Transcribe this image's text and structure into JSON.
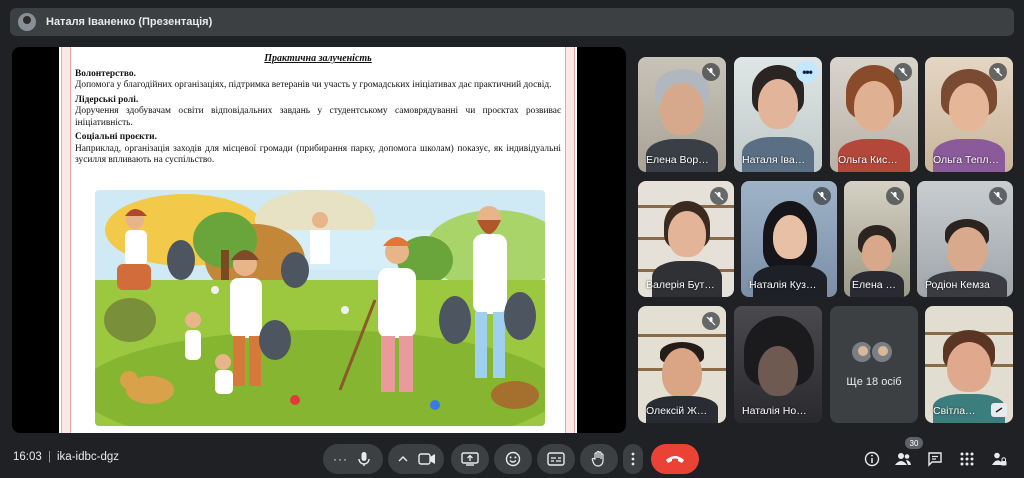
{
  "window": {
    "title": "Наталя Іваненко (Презентація)"
  },
  "slide": {
    "title": "Практична залученість",
    "sections": [
      {
        "heading": "Волонтерство.",
        "text": "Допомога у благодійних організаціях, підтримка ветеранів чи участь у громадських ініціативах дає практичний досвід."
      },
      {
        "heading": "Лідерські ролі.",
        "text": "Доручення здобувачам освіти відповідальних завдань у студентському самоврядуванні чи проєктах розвиває ініціативність."
      },
      {
        "heading": "Соціальні проєкти.",
        "text": "Наприклад, організація заходів для місцевої громади (прибирання парку, допомога школам) показує, як індивідуальні зусилля впливають на суспільство."
      }
    ]
  },
  "participants": [
    {
      "name": "Елена Вор…",
      "muted": true
    },
    {
      "name": "Наталя Іва…",
      "muted": false,
      "active": true
    },
    {
      "name": "Ольга Кис…",
      "muted": true
    },
    {
      "name": "Ольга Тепл…",
      "muted": true
    },
    {
      "name": "Валерія Бут…",
      "muted": true
    },
    {
      "name": "Наталія Куз…",
      "muted": true
    },
    {
      "name": "Елена …",
      "muted": true
    },
    {
      "name": "Родіон Кемза",
      "muted": true
    },
    {
      "name": "Олексій Ж…",
      "muted": true
    },
    {
      "name": "Наталія Но…",
      "muted": false
    },
    {
      "name": "Світла…",
      "muted": false
    }
  ],
  "more_tile": {
    "label": "Ще 18 осіб"
  },
  "bottom": {
    "time": "16:03",
    "separator": "|",
    "meeting_code": "ika-idbc-dgz",
    "people_count": "30"
  },
  "colors": {
    "end_call": "#ea4335",
    "active_outline": "#8ab4f8",
    "bar": "#3c4043"
  }
}
